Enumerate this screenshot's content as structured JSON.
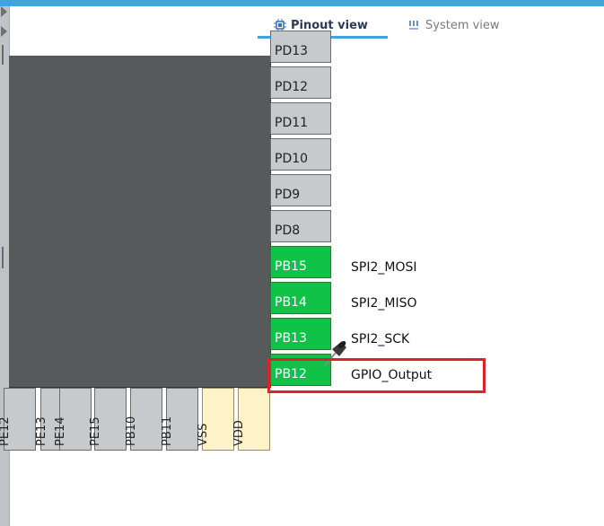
{
  "tabs": [
    {
      "label": "Pinout view",
      "icon": "chip-icon",
      "active": true
    },
    {
      "label": "System view",
      "icon": "system-view-icon",
      "active": false
    }
  ],
  "right_pins": [
    {
      "name": "PD13",
      "label": "",
      "assigned": false
    },
    {
      "name": "PD12",
      "label": "",
      "assigned": false
    },
    {
      "name": "PD11",
      "label": "",
      "assigned": false
    },
    {
      "name": "PD10",
      "label": "",
      "assigned": false
    },
    {
      "name": "PD9",
      "label": "",
      "assigned": false
    },
    {
      "name": "PD8",
      "label": "",
      "assigned": false
    },
    {
      "name": "PB15",
      "label": "SPI2_MOSI",
      "assigned": true
    },
    {
      "name": "PB14",
      "label": "SPI2_MISO",
      "assigned": true
    },
    {
      "name": "PB13",
      "label": "SPI2_SCK",
      "assigned": true
    },
    {
      "name": "PB12",
      "label": "GPIO_Output",
      "assigned": true
    }
  ],
  "bottom_pins": [
    {
      "name": "PE12",
      "type": "io"
    },
    {
      "name": "PE13",
      "type": "io"
    },
    {
      "name": "PE14",
      "type": "io"
    },
    {
      "name": "PE15",
      "type": "io"
    },
    {
      "name": "PB10",
      "type": "io"
    },
    {
      "name": "PB11",
      "type": "io"
    },
    {
      "name": "VSS",
      "type": "power"
    },
    {
      "name": "VDD",
      "type": "power"
    }
  ],
  "colors": {
    "accent": "#3ea6dc",
    "assigned_pin": "#10c247",
    "unassigned_pin": "#c6cacd",
    "power_pin": "#fdf2c8",
    "highlight": "#d7262b",
    "chip_body": "#575a5b"
  }
}
